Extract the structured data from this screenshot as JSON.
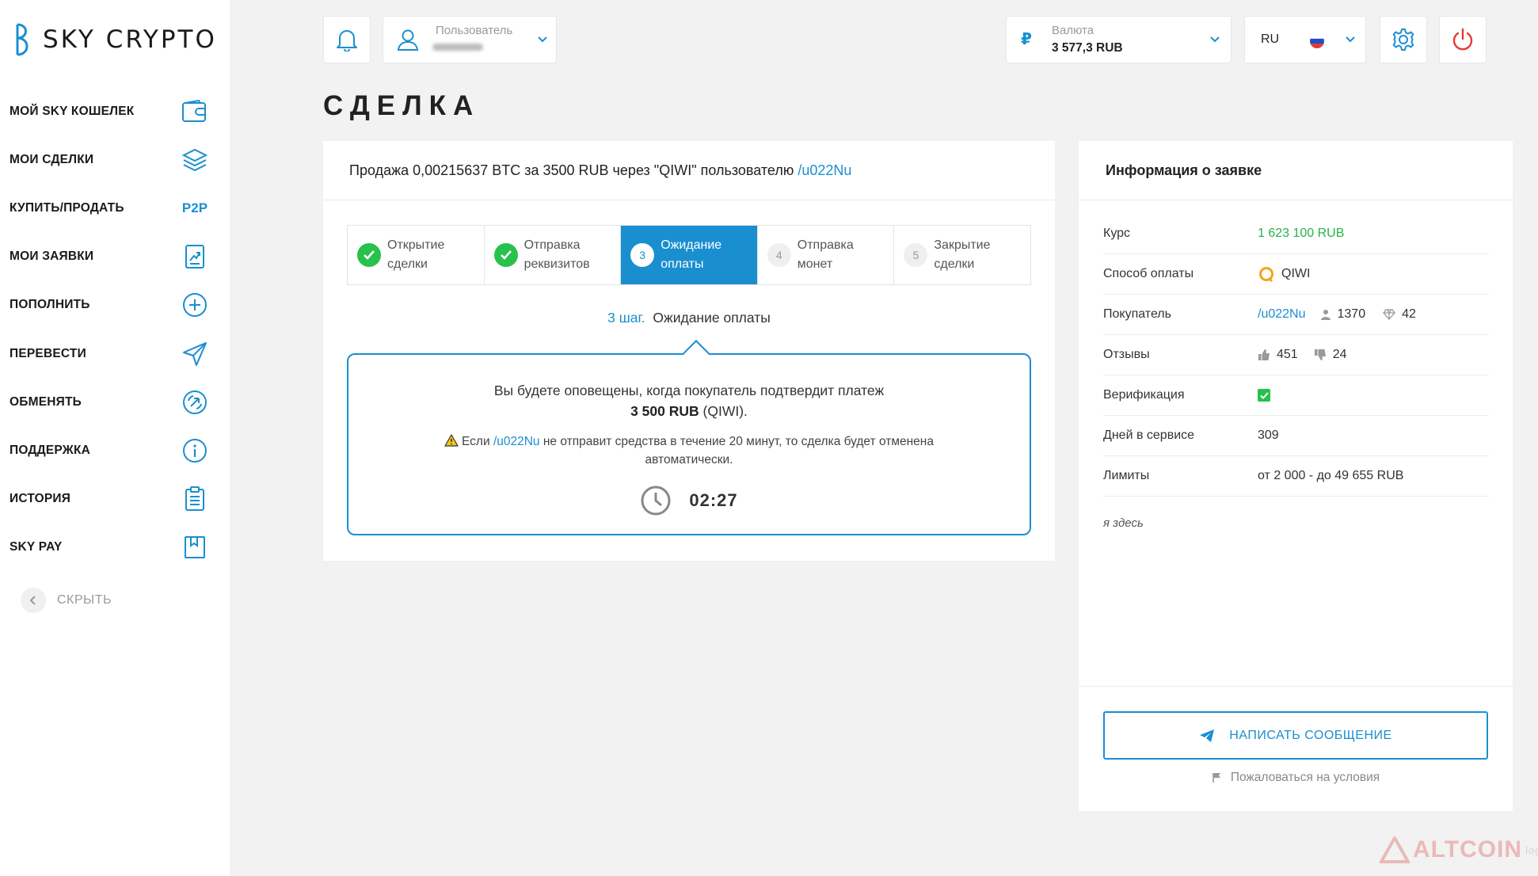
{
  "brand": {
    "logo_letter": "B",
    "name": "SKY CRYPTO"
  },
  "sidebar": {
    "items": [
      {
        "label": "МОЙ SKY КОШЕЛЕК",
        "icon": "wallet-icon"
      },
      {
        "label": "МОИ СДЕЛКИ",
        "icon": "layers-icon"
      },
      {
        "label": "КУПИТЬ/ПРОДАТЬ",
        "icon": "p2p-icon",
        "badge": "P2P"
      },
      {
        "label": "МОИ ЗАЯВКИ",
        "icon": "chart-doc-icon"
      },
      {
        "label": "ПОПОЛНИТЬ",
        "icon": "plus-circle-icon"
      },
      {
        "label": "ПЕРЕВЕСТИ",
        "icon": "send-icon"
      },
      {
        "label": "ОБМЕНЯТЬ",
        "icon": "exchange-icon"
      },
      {
        "label": "ПОДДЕРЖКА",
        "icon": "info-icon"
      },
      {
        "label": "ИСТОРИЯ",
        "icon": "clipboard-icon"
      },
      {
        "label": "SKY PAY",
        "icon": "bookmark-icon"
      }
    ],
    "hide_label": "СКРЫТЬ"
  },
  "topbar": {
    "user_label": "Пользователь",
    "currency_label": "Валюта",
    "currency_symbol": "₽",
    "currency_value": "3 577,3 RUB",
    "language": "RU"
  },
  "page": {
    "title": "СДЕЛКА"
  },
  "deal": {
    "header_prefix": "Продажа 0,00215637 BTC за 3500 RUB через \"QIWI\" пользователю ",
    "header_user": "/u022Nu",
    "steps": [
      {
        "num": "1",
        "line1": "Открытие",
        "line2": "сделки",
        "state": "done"
      },
      {
        "num": "2",
        "line1": "Отправка",
        "line2": "реквизитов",
        "state": "done"
      },
      {
        "num": "3",
        "line1": "Ожидание",
        "line2": "оплаты",
        "state": "active"
      },
      {
        "num": "4",
        "line1": "Отправка",
        "line2": "монет",
        "state": "pending"
      },
      {
        "num": "5",
        "line1": "Закрытие",
        "line2": "сделки",
        "state": "pending"
      }
    ],
    "step_label": "3 шаг.",
    "step_name": "Ожидание оплаты",
    "notice_line1": "Вы будете оповещены, когда покупатель подтвердит платеж",
    "notice_amount": "3 500 RUB",
    "notice_method": "(QIWI).",
    "warning_prefix": "Если ",
    "warning_user": "/u022Nu",
    "warning_suffix": " не отправит средства в течение 20 минут, то сделка будет отменена автоматически.",
    "timer": "02:27"
  },
  "info": {
    "title": "Информация о заявке",
    "rate_label": "Курс",
    "rate_value": "1 623 100 RUB",
    "payment_label": "Способ оплаты",
    "payment_value": "QIWI",
    "buyer_label": "Покупатель",
    "buyer_value": "/u022Nu",
    "buyer_deals": "1370",
    "buyer_rating": "42",
    "reviews_label": "Отзывы",
    "reviews_positive": "451",
    "reviews_negative": "24",
    "verification_label": "Верификация",
    "days_label": "Дней в сервисе",
    "days_value": "309",
    "limits_label": "Лимиты",
    "limits_value": "от 2 000 - до 49 655 RUB",
    "note": "я здесь",
    "message_button": "НАПИСАТЬ СООБЩЕНИЕ",
    "complain": "Пожаловаться на условия"
  },
  "watermark": {
    "text": "ALTCOIN",
    "suffix": "log"
  },
  "colors": {
    "accent": "#1a8fd0",
    "success": "#27c24c",
    "danger": "#e53935",
    "background": "#f2f2f2"
  }
}
